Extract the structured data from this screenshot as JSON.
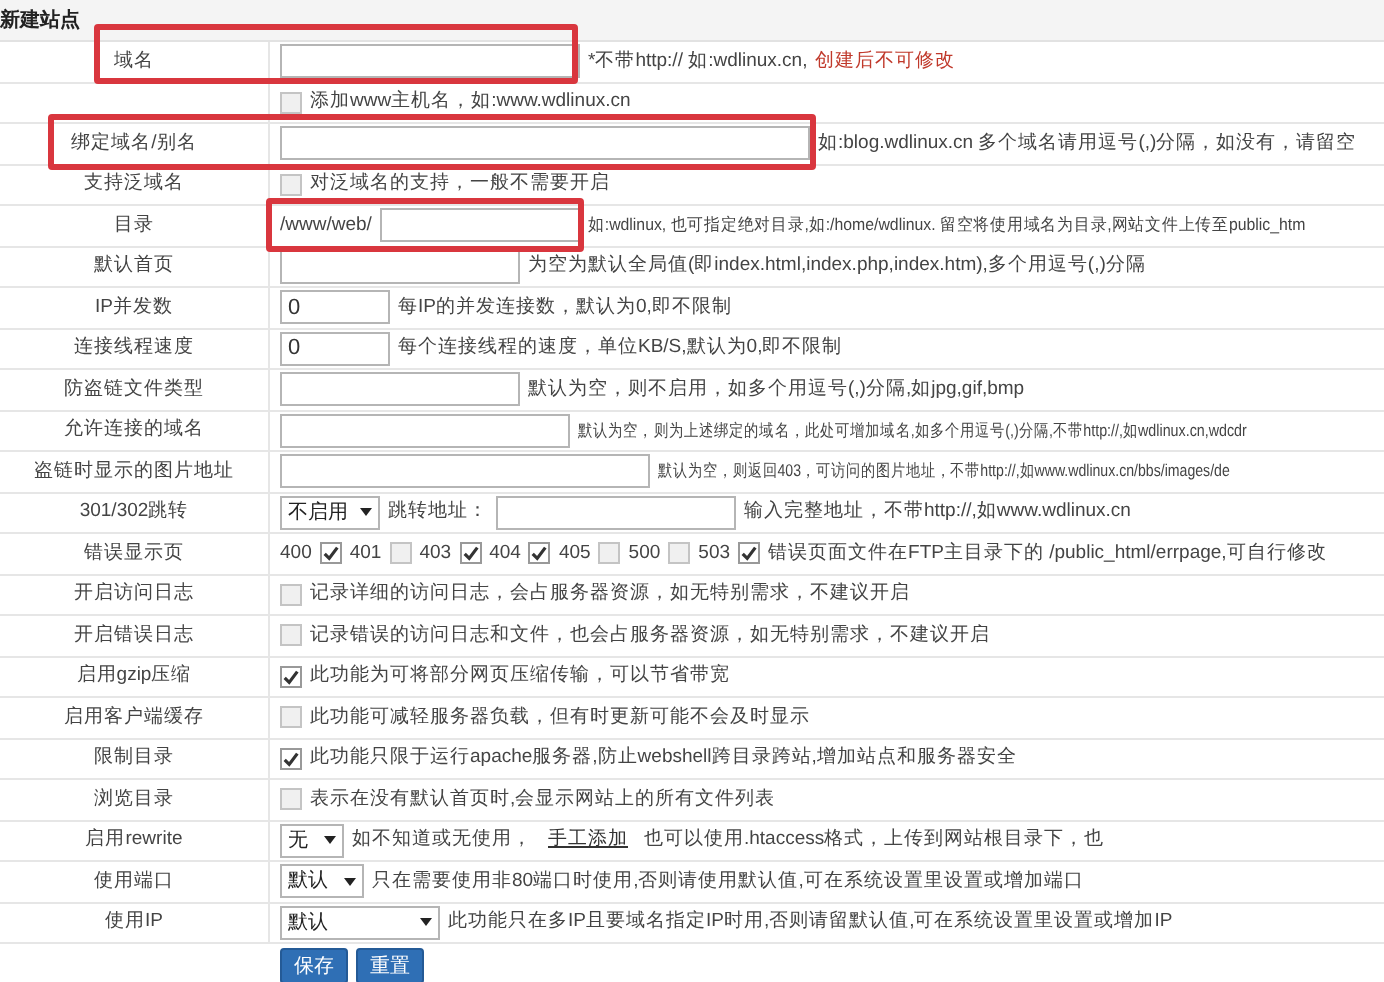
{
  "header": {
    "title": "新建站点"
  },
  "rows": [
    {
      "label": "域名",
      "highlighted": true,
      "parts": [
        {
          "kind": "input"
        },
        {
          "kind": "text",
          "text": "*不带http:// 如:wdlinux.cn,"
        },
        {
          "kind": "warning",
          "text": "创建后不可修改"
        }
      ]
    },
    {
      "parts": [
        {
          "kind": "checkbox",
          "checked": false
        },
        {
          "kind": "text",
          "text": "添加www主机名，如:www.wdlinux.cn"
        }
      ]
    },
    {
      "label": "绑定域名/别名",
      "highlighted": true,
      "parts": [
        {
          "kind": "input"
        },
        {
          "kind": "text",
          "text": "如:blog.wdlinux.cn 多个域名请用逗号(,)分隔，如没有，请留空"
        }
      ]
    },
    {
      "label": "支持泛域名",
      "parts": [
        {
          "kind": "checkbox",
          "checked": false
        },
        {
          "kind": "text",
          "text": "对泛域名的支持，一般不需要开启"
        }
      ]
    },
    {
      "label": "目录",
      "highlighted": true,
      "parts": [
        {
          "kind": "text",
          "text": "/www/web/"
        },
        {
          "kind": "input"
        },
        {
          "kind": "text",
          "text": "如:wdlinux, 也可指定绝对目录,如:/home/wdlinux. 留空将使用域名为目录,网站文件上传至public_htm"
        }
      ]
    },
    {
      "label": "默认首页",
      "parts": [
        {
          "kind": "input"
        },
        {
          "kind": "text",
          "text": "为空为默认全局值(即index.html,index.php,index.htm),多个用逗号(,)分隔"
        }
      ]
    },
    {
      "label": "IP并发数",
      "parts": [
        {
          "kind": "input",
          "value": "0"
        },
        {
          "kind": "text",
          "text": "每IP的并发连接数，默认为0,即不限制"
        }
      ]
    },
    {
      "label": "连接线程速度",
      "parts": [
        {
          "kind": "input",
          "value": "0"
        },
        {
          "kind": "text",
          "text": "每个连接线程的速度，单位KB/S,默认为0,即不限制"
        }
      ]
    },
    {
      "label": "防盗链文件类型",
      "parts": [
        {
          "kind": "input"
        },
        {
          "kind": "text",
          "text": "默认为空，则不启用，如多个用逗号(,)分隔,如jpg,gif,bmp"
        }
      ]
    },
    {
      "label": "允许连接的域名",
      "parts": [
        {
          "kind": "input"
        },
        {
          "kind": "text",
          "text": "默认为空，则为上述绑定的域名，此处可增加域名,如多个用逗号(,)分隔,不带http://,如wdlinux.cn,wdcdr"
        }
      ]
    },
    {
      "label": "盗链时显示的图片地址",
      "parts": [
        {
          "kind": "input"
        },
        {
          "kind": "text",
          "text": "默认为空，则返回403，可访问的图片地址，不带http://,如www.wdlinux.cn/bbs/images/de"
        }
      ]
    },
    {
      "label": "301/302跳转",
      "parts": [
        {
          "kind": "select",
          "value": "不启用"
        },
        {
          "kind": "text",
          "text": "跳转地址："
        },
        {
          "kind": "input"
        },
        {
          "kind": "text",
          "text": "输入完整地址，不带http://,如www.wdlinux.cn"
        }
      ]
    },
    {
      "label": "错误显示页",
      "parts": [
        {
          "kind": "text",
          "text": "400"
        },
        {
          "kind": "checkbox",
          "checked": true
        },
        {
          "kind": "text",
          "text": "401"
        },
        {
          "kind": "checkbox",
          "checked": false
        },
        {
          "kind": "text",
          "text": "403"
        },
        {
          "kind": "checkbox",
          "checked": true
        },
        {
          "kind": "text",
          "text": "404"
        },
        {
          "kind": "checkbox",
          "checked": true
        },
        {
          "kind": "text",
          "text": "405"
        },
        {
          "kind": "checkbox",
          "checked": false
        },
        {
          "kind": "text",
          "text": "500"
        },
        {
          "kind": "checkbox",
          "checked": false
        },
        {
          "kind": "text",
          "text": "503"
        },
        {
          "kind": "checkbox",
          "checked": true
        },
        {
          "kind": "text",
          "text": "错误页面文件在FTP主目录下的 /public_html/errpage,可自行修改"
        }
      ]
    },
    {
      "label": "开启访问日志",
      "parts": [
        {
          "kind": "checkbox",
          "checked": false
        },
        {
          "kind": "text",
          "text": "记录详细的访问日志，会占服务器资源，如无特别需求，不建议开启"
        }
      ]
    },
    {
      "label": "开启错误日志",
      "parts": [
        {
          "kind": "checkbox",
          "checked": false
        },
        {
          "kind": "text",
          "text": "记录错误的访问日志和文件，也会占服务器资源，如无特别需求，不建议开启"
        }
      ]
    },
    {
      "label": "启用gzip压缩",
      "parts": [
        {
          "kind": "checkbox",
          "checked": true
        },
        {
          "kind": "text",
          "text": "此功能为可将部分网页压缩传输，可以节省带宽"
        }
      ]
    },
    {
      "label": "启用客户端缓存",
      "parts": [
        {
          "kind": "checkbox",
          "checked": false
        },
        {
          "kind": "text",
          "text": "此功能可减轻服务器负载，但有时更新可能不会及时显示"
        }
      ]
    },
    {
      "label": "限制目录",
      "parts": [
        {
          "kind": "checkbox",
          "checked": true
        },
        {
          "kind": "text",
          "text": "此功能只限于运行apache服务器,防止webshell跨目录跨站,增加站点和服务器安全"
        }
      ]
    },
    {
      "label": "浏览目录",
      "parts": [
        {
          "kind": "checkbox",
          "checked": false
        },
        {
          "kind": "text",
          "text": "表示在没有默认首页时,会显示网站上的所有文件列表"
        }
      ]
    },
    {
      "label": "启用rewrite",
      "parts": [
        {
          "kind": "select",
          "value": "无"
        },
        {
          "kind": "text",
          "text": "如不知道或无使用，"
        },
        {
          "kind": "link",
          "text": "手工添加"
        },
        {
          "kind": "text",
          "text": "也可以使用.htaccess格式，上传到网站根目录下，也"
        }
      ]
    },
    {
      "label": "使用端口",
      "parts": [
        {
          "kind": "select",
          "value": "默认"
        },
        {
          "kind": "text",
          "text": "只在需要使用非80端口时使用,否则请使用默认值,可在系统设置里设置或增加端口"
        }
      ]
    },
    {
      "label": "使用IP",
      "parts": [
        {
          "kind": "select",
          "value": "默认"
        },
        {
          "kind": "text",
          "text": "此功能只在多IP且要域名指定IP时用,否则请留默认值,可在系统设置里设置或增加IP"
        }
      ]
    }
  ],
  "buttons": [
    "保存",
    "重置"
  ]
}
